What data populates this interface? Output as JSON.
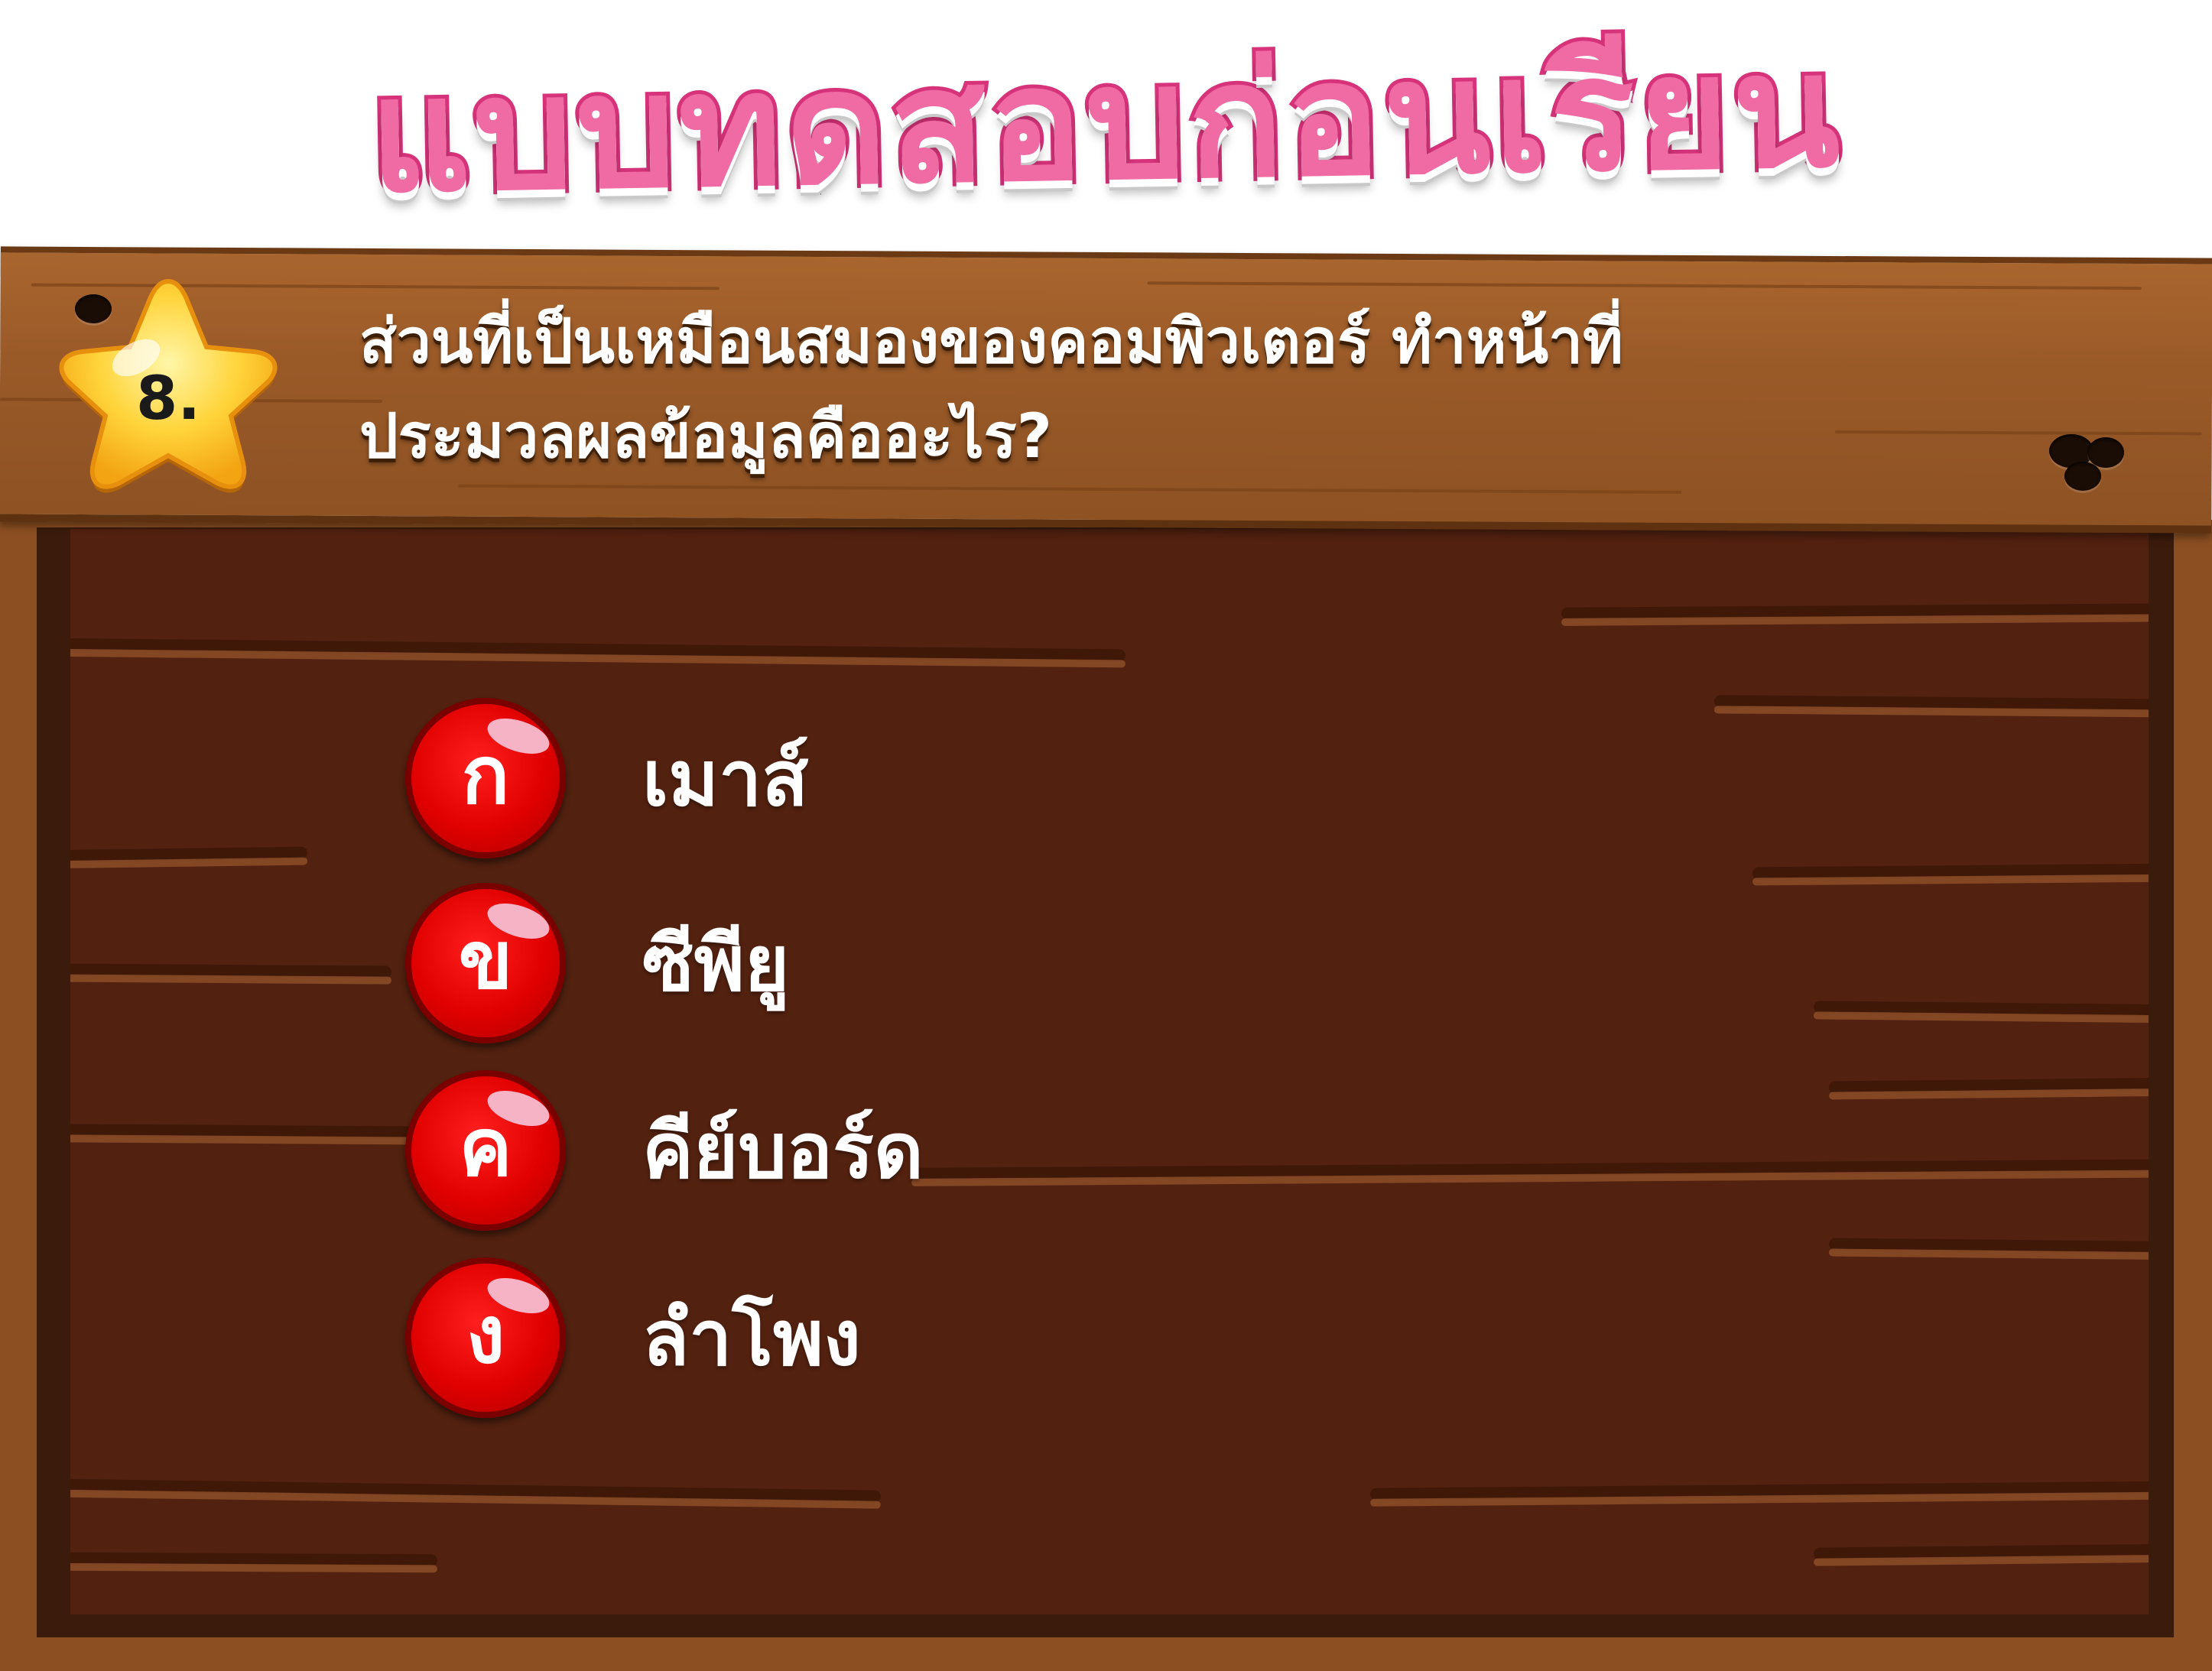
{
  "page": {
    "title": "แบบทดสอบก่อนเรียน"
  },
  "question": {
    "number": "8.",
    "text_line1": "ส่วนที่เป็นเหมือนสมองของคอมพิวเตอร์ ทำหน้าที่",
    "text_line2": "ประมวลผลข้อมูลคืออะไร?"
  },
  "options": [
    {
      "letter": "ก",
      "text": "เมาส์"
    },
    {
      "letter": "ข",
      "text": "ซีพียู"
    },
    {
      "letter": "ค",
      "text": "คีย์บอร์ด"
    },
    {
      "letter": "ง",
      "text": "ลำโพง"
    }
  ],
  "colors": {
    "title": "#f06aa4",
    "plank": "#9a5a28",
    "board": "#522110",
    "option_badge": "#e00000",
    "star": "#f7c21b"
  },
  "icons": {
    "badge": "star-icon"
  }
}
